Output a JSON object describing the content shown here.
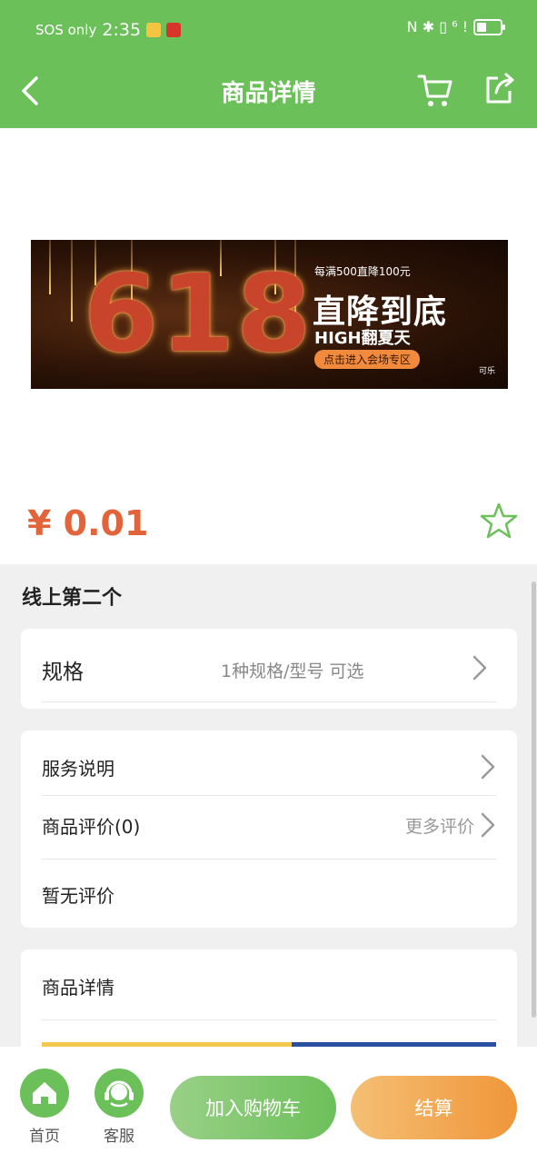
{
  "status_bar": {
    "carrier": "SOS only",
    "time": "2:35",
    "indicators": "N ✱ ▯ ⁶ !"
  },
  "nav": {
    "title": "商品详情",
    "back_icon": "chevron-left-icon",
    "cart_icon": "cart-icon",
    "share_icon": "share-icon"
  },
  "banner": {
    "big_number": "618",
    "subtitle": "每满500直降100元",
    "headline": "直降到底",
    "high_text": "HIGH翻夏天",
    "button_text": "点击进入会场专区",
    "logo_text": "可乐"
  },
  "product": {
    "price": "¥ 0.01",
    "name": "线上第二个"
  },
  "spec": {
    "label": "规格",
    "value": "1种规格/型号 可选"
  },
  "service": {
    "label": "服务说明",
    "reviews_label": "商品评价(0)",
    "more_reviews": "更多评价",
    "no_reviews": "暂无评价"
  },
  "detail": {
    "label": "商品详情"
  },
  "bottom": {
    "home_label": "首页",
    "service_label": "客服",
    "add_cart_label": "加入购物车",
    "checkout_label": "结算"
  },
  "colors": {
    "primary_green": "#6cc05a",
    "price_orange": "#e2643a",
    "checkout_orange": "#f0963a"
  }
}
